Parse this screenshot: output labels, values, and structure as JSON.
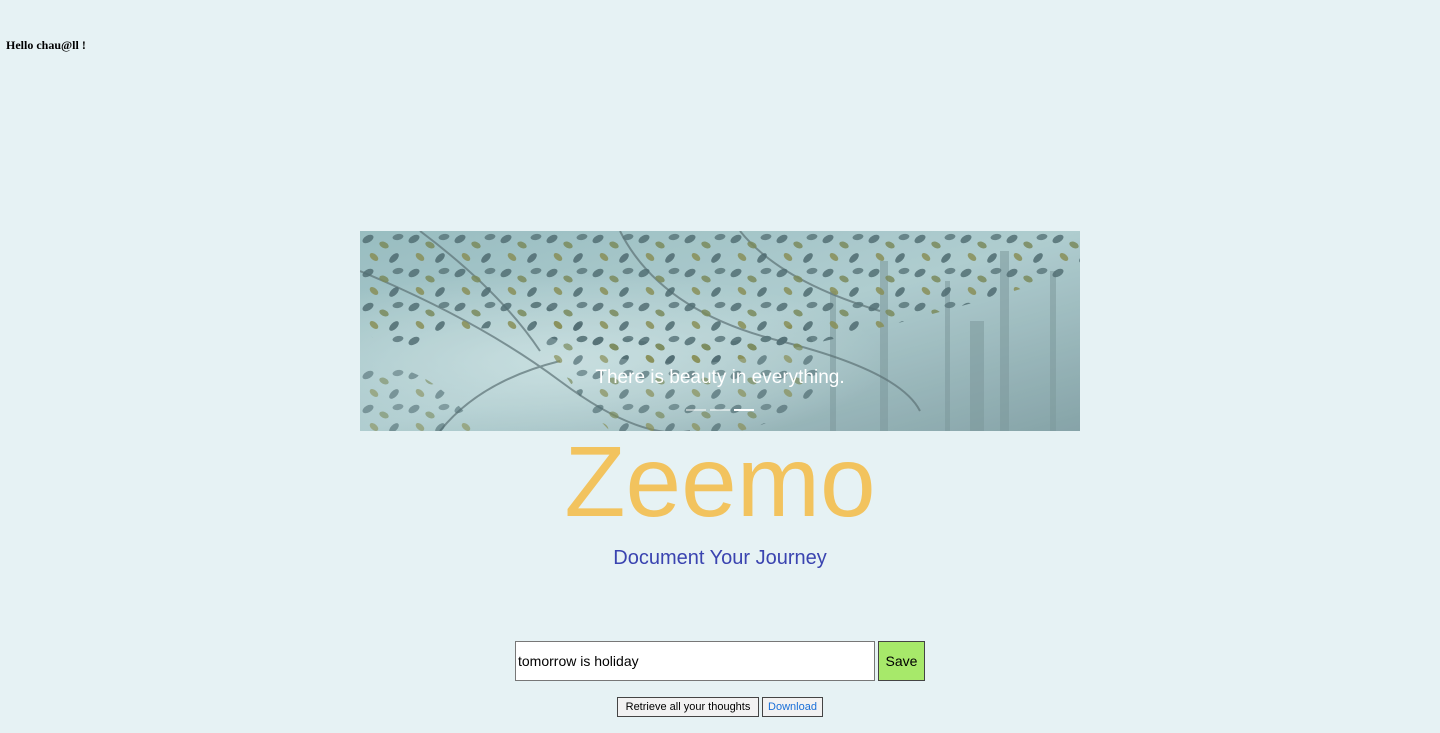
{
  "header": {
    "greeting": "Hello chau@ll !"
  },
  "carousel": {
    "caption": "There is beauty in everything.",
    "slide_count": 3,
    "active_slide": 3,
    "image": "forest-trees-foliage"
  },
  "brand": {
    "name": "Zeemo",
    "tagline": "Document Your Journey",
    "name_color": "#f2c35e",
    "tagline_color": "#3a44b0"
  },
  "form": {
    "thought_value": "tomorrow is holiday",
    "save_label": "Save",
    "save_color": "#a7e96a",
    "retrieve_label": "Retrieve all your thoughts",
    "download_label": "Download"
  },
  "colors": {
    "background": "#e6f2f4"
  }
}
